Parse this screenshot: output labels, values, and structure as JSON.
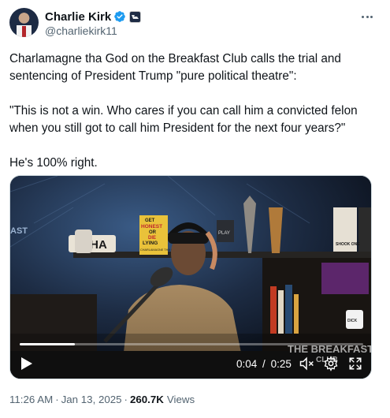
{
  "author": {
    "display_name": "Charlie Kirk",
    "handle": "@charliekirk11",
    "verified_color": "#1d9bf0"
  },
  "post": {
    "paragraphs": [
      "Charlamagne tha God on the Breakfast Club calls the trial and sentencing of President Trump \"pure political theatre\":",
      "\"This is not a win. Who cares if you can call him a convicted felon when you still got to call him President for the next four years?\"",
      "He's 100% right."
    ]
  },
  "video": {
    "current_time": "0:04",
    "duration": "0:25",
    "time_separator": "/",
    "progress_fraction": 0.16,
    "overlay_text": {
      "studio_sign": "THA",
      "book_title": [
        "GET",
        "HONEST",
        "OR",
        "DIE",
        "LYING"
      ],
      "book_author": "CHARLAMAGNE THA GOD",
      "shelf_book": "SHOOK ONE",
      "mug_text": "DICK",
      "watermark_main": "THE BREAKFAST",
      "watermark_sub": "CLUB",
      "plaque": "PLAY",
      "wall_text": "AST"
    }
  },
  "footer": {
    "time": "11:26 AM",
    "separator": "·",
    "date": "Jan 13, 2025",
    "views_count": "260.7K",
    "views_label": "Views"
  },
  "icons": {
    "more": "more-dots-icon",
    "verified": "verified-badge-icon",
    "affiliation": "affiliation-badge-icon",
    "play": "play-icon",
    "mute": "volume-muted-icon",
    "settings": "settings-gear-icon",
    "fullscreen": "fullscreen-icon"
  }
}
